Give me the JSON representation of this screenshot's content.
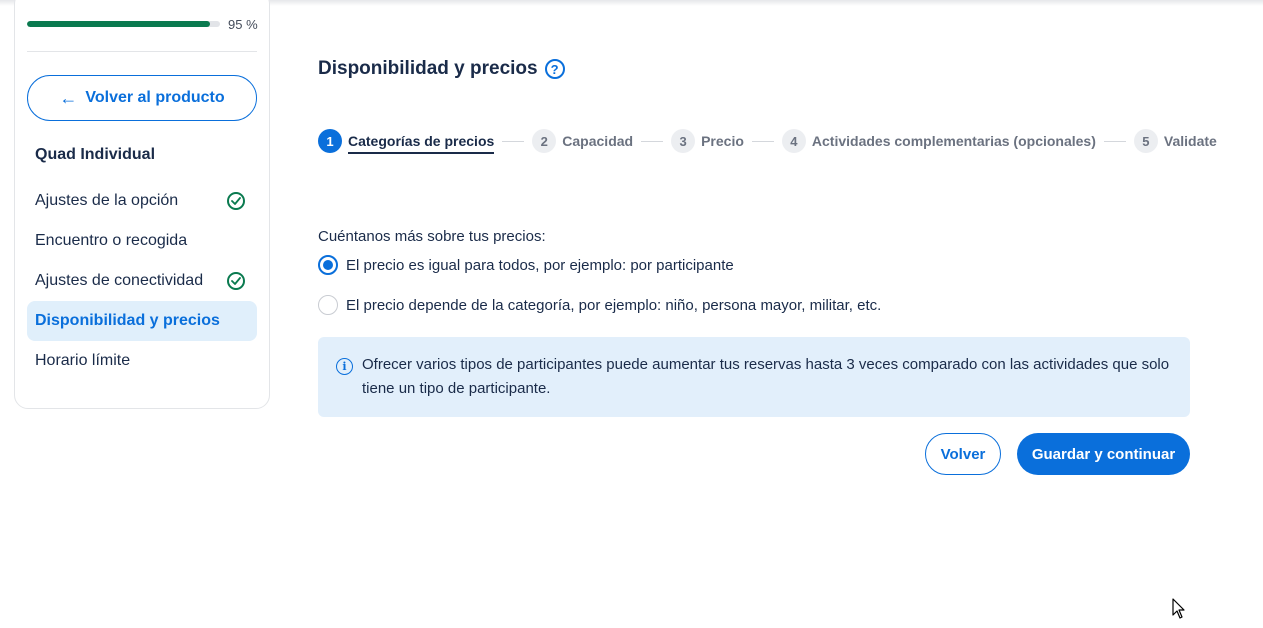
{
  "sidebar": {
    "progress_percent": 95,
    "progress_label": "95 %",
    "back_label": "Volver al producto",
    "product_name": "Quad Individual",
    "items": [
      {
        "label": "Ajustes de la opción",
        "completed": true,
        "active": false
      },
      {
        "label": "Encuentro o recogida",
        "completed": false,
        "active": false
      },
      {
        "label": "Ajustes de conectividad",
        "completed": true,
        "active": false
      },
      {
        "label": "Disponibilidad y precios",
        "completed": false,
        "active": true
      },
      {
        "label": "Horario límite",
        "completed": false,
        "active": false
      }
    ]
  },
  "main": {
    "title": "Disponibilidad y precios",
    "help_icon": "?",
    "steps": [
      {
        "number": "1",
        "label": "Categorías de precios",
        "active": true
      },
      {
        "number": "2",
        "label": "Capacidad",
        "active": false
      },
      {
        "number": "3",
        "label": "Precio",
        "active": false
      },
      {
        "number": "4",
        "label": "Actividades complementarias (opcionales)",
        "active": false
      },
      {
        "number": "5",
        "label": "Validate",
        "active": false
      }
    ],
    "question": "Cuéntanos más sobre tus precios:",
    "options": [
      {
        "label": "El precio es igual para todos, por ejemplo: por participante",
        "checked": true
      },
      {
        "label": "El precio depende de la categoría, por ejemplo: niño, persona mayor, militar, etc.",
        "checked": false
      }
    ],
    "info_icon": "i",
    "info_text": "Ofrecer varios tipos de participantes puede aumentar tus reservas hasta 3 veces comparado con las actividades que solo tiene un tipo de participante.",
    "back_button": "Volver",
    "save_button": "Guardar y continuar"
  },
  "colors": {
    "accent": "#0a6fdb",
    "success": "#0a7a4f",
    "text": "#1a2b49",
    "info_bg": "#e2effb"
  },
  "icons": [
    "arrow-left-icon",
    "check-circle-icon",
    "help-circle-icon",
    "info-icon",
    "mouse-cursor-icon"
  ]
}
